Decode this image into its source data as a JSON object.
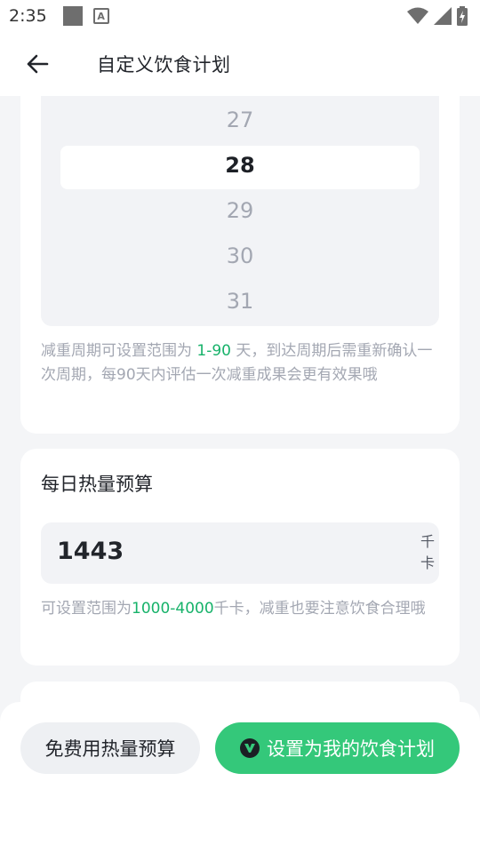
{
  "status_bar": {
    "time": "2:35",
    "notif_letter": "A"
  },
  "header": {
    "title": "自定义饮食计划"
  },
  "period": {
    "picker_items": [
      "27",
      "28",
      "29",
      "30",
      "31"
    ],
    "selected": "28",
    "hint_pre": "减重周期可设置范围为 ",
    "hint_range": "1-90",
    "hint_post": " 天，到达周期后需重新确认一次周期，每90天内评估一次减重成果会更有效果哦"
  },
  "calorie": {
    "title": "每日热量预算",
    "value": "1443",
    "unit": "千卡",
    "hint_pre": "可设置范围为",
    "hint_range": "1000-4000",
    "hint_post": "千卡，减重也要注意饮食合理哦"
  },
  "bottom": {
    "free_button": "免费用热量预算",
    "set_button": "设置为我的饮食计划"
  },
  "colors": {
    "accent": "#34c87a",
    "highlight": "#17b26a"
  }
}
